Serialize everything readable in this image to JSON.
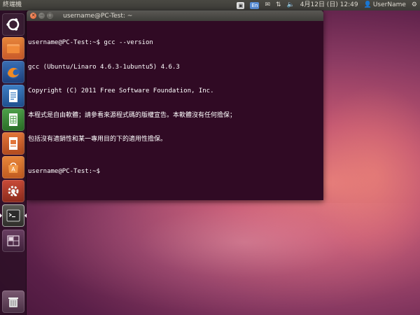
{
  "top_panel": {
    "app_title": "終端機",
    "keyboard_indicator": "En",
    "datetime": "4月12日 (日) 12:49",
    "user": "UserName"
  },
  "terminal": {
    "window_title": "username@PC-Test: ~",
    "lines": [
      "username@PC-Test:~$ gcc --version",
      "gcc (Ubuntu/Linaro 4.6.3-1ubuntu5) 4.6.3",
      "Copyright (C) 2011 Free Software Foundation, Inc.",
      "本程式是自由軟體；請參看來源程式碼的版權宣告。本軟體沒有任何擔保；",
      "包括沒有適銷性和某一專用目的下的適用性擔保。"
    ],
    "prompt": "username@PC-Test:~$ "
  },
  "launcher": {
    "items": [
      {
        "icon": "ubuntu-dash-icon"
      },
      {
        "icon": "files-folder-icon"
      },
      {
        "icon": "firefox-icon"
      },
      {
        "icon": "writer-document-icon"
      },
      {
        "icon": "calc-spreadsheet-icon"
      },
      {
        "icon": "impress-presentation-icon"
      },
      {
        "icon": "software-center-icon"
      },
      {
        "icon": "system-settings-icon"
      },
      {
        "icon": "terminal-icon"
      },
      {
        "icon": "workspace-switcher-icon"
      },
      {
        "icon": "trash-icon"
      }
    ]
  },
  "colors": {
    "terminal_bg": "#300a24",
    "panel_bg": "#3c3b37",
    "close_button": "#e45a26"
  }
}
